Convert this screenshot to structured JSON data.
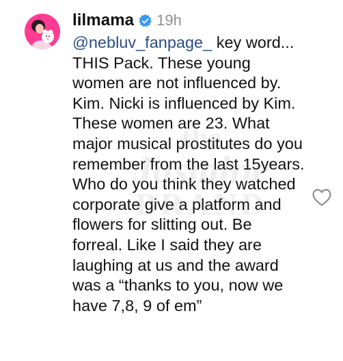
{
  "comment": {
    "username": "lilmama",
    "verified_icon": "verified-badge-icon",
    "timestamp": "19h",
    "mention": "@nebluv_fanpage_",
    "text_after_mention": " key word... THIS Pack. These young women are not influenced by. Kim. Nicki is influenced by Kim. These women are 23. What major musical prostitutes do you remember from the last 15years. Who do you think they watched corporate give a platform and flowers for slitting out. Be forreal. Like I said they are laughing at us and the award was a “thanks to you, now we have 7,8, 9 of em”",
    "like_icon": "heart-outline-icon"
  },
  "watermark": {
    "line1": "the",
    "line2": "Jasmine",
    "line3": "BRAND"
  },
  "colors": {
    "mention": "#2b4d86",
    "verified": "#3897f0",
    "timestamp": "#8e8e8e",
    "avatar_ring": "#ff2d87"
  }
}
